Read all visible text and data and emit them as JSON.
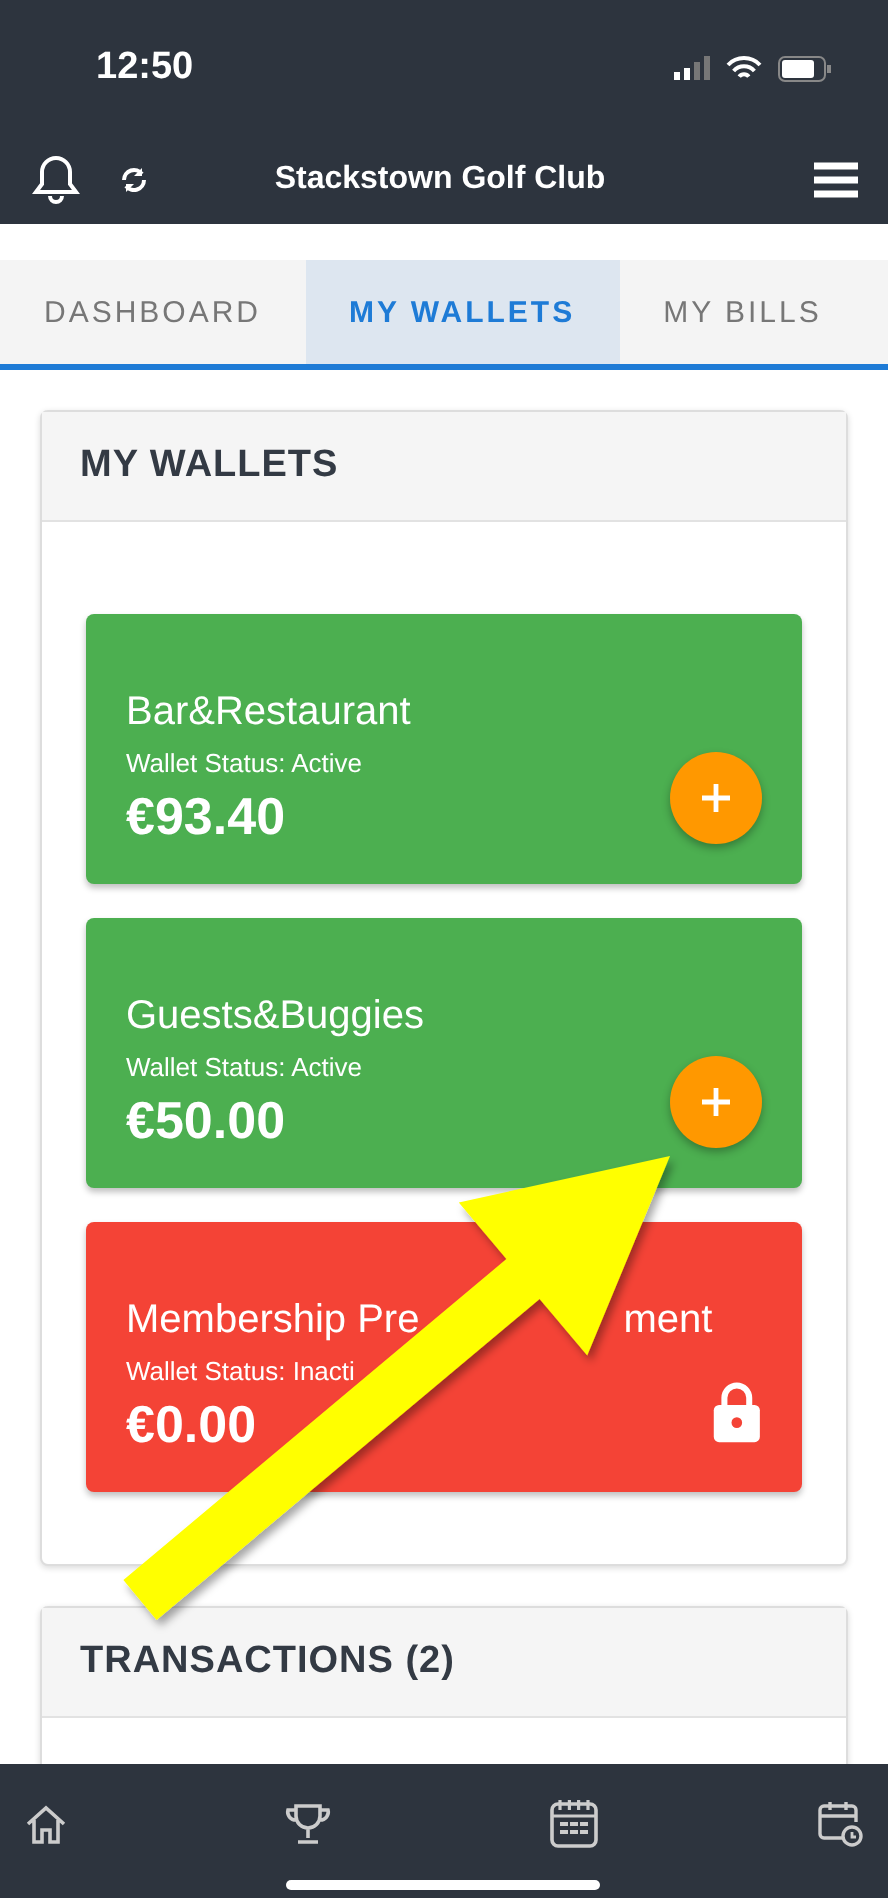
{
  "status_bar": {
    "time": "12:50"
  },
  "header": {
    "title": "Stackstown Golf Club"
  },
  "tabs": [
    {
      "label": "DASHBOARD",
      "selected": false
    },
    {
      "label": "MY WALLETS",
      "selected": true
    },
    {
      "label": "MY BILLS",
      "selected": false
    }
  ],
  "wallets_panel": {
    "title": "MY WALLETS",
    "wallets": [
      {
        "title_parts": [
          "Bar&Restaurant"
        ],
        "status": "Wallet Status: Active",
        "balance": "€93.40",
        "color": "#4caf50",
        "kind": "add"
      },
      {
        "title_parts": [
          "Guests&Buggies"
        ],
        "status": "Wallet Status: Active",
        "balance": "€50.00",
        "color": "#4caf50",
        "kind": "add"
      },
      {
        "title_parts": [
          "Membership Pre",
          "ment"
        ],
        "status": "Wallet Status: Inacti",
        "balance": "€0.00",
        "color": "#f44336",
        "kind": "locked"
      }
    ]
  },
  "transactions_panel": {
    "title": "TRANSACTIONS (2)"
  }
}
